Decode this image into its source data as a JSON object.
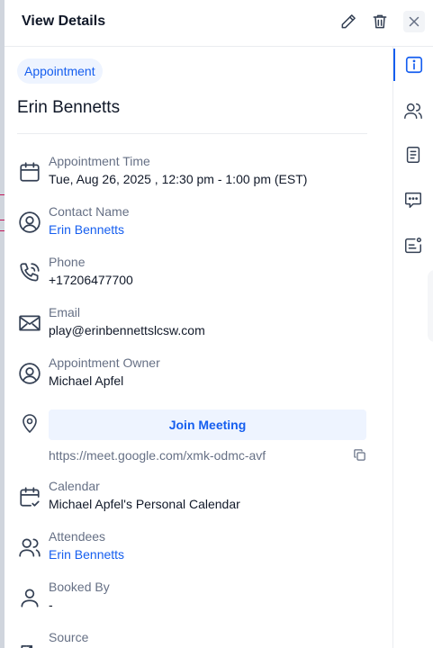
{
  "header": {
    "title": "View Details",
    "icons": [
      "pencil-icon",
      "trash-icon",
      "close-icon"
    ]
  },
  "appointment": {
    "badge": "Appointment",
    "contact_title": "Erin Bennetts"
  },
  "fields": {
    "appointment_time": {
      "label": "Appointment Time",
      "value": "Tue, Aug 26, 2025 , 12:30 pm - 1:00 pm (EST)"
    },
    "contact_name": {
      "label": "Contact Name",
      "value": "Erin Bennetts"
    },
    "phone": {
      "label": "Phone",
      "value": "+17206477700"
    },
    "email": {
      "label": "Email",
      "value": "play@erinbennettslcsw.com"
    },
    "owner": {
      "label": "Appointment Owner",
      "value": "Michael Apfel"
    },
    "meeting": {
      "button": "Join Meeting",
      "url": "https://meet.google.com/xmk-odmc-avf"
    },
    "calendar": {
      "label": "Calendar",
      "value": "Michael Apfel's Personal Calendar"
    },
    "attendees": {
      "label": "Attendees",
      "value": "Erin Bennetts"
    },
    "booked_by": {
      "label": "Booked By",
      "value": "-"
    },
    "source": {
      "label": "Source"
    }
  },
  "rail": [
    "info-icon",
    "users-icon",
    "notes-icon",
    "chat-icon",
    "ticket-icon"
  ],
  "colors": {
    "accent": "#155eef",
    "badge_bg": "#eef4ff",
    "muted": "#667085",
    "text": "#101828"
  }
}
